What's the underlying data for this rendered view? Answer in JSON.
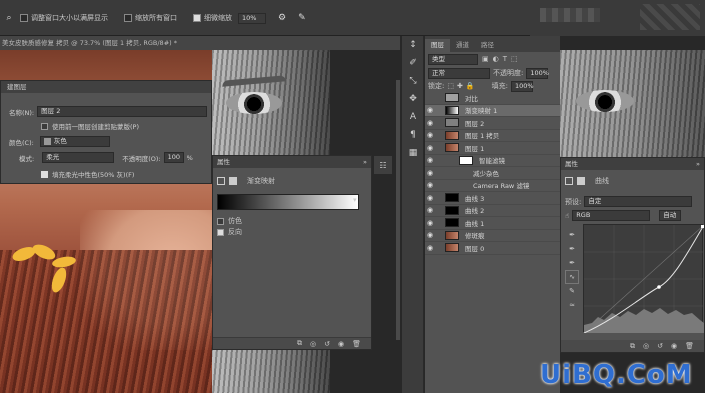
{
  "options_bar": {
    "resize_windows": "调整窗口大小以满屏显示",
    "zoom_all": "缩放所有窗口",
    "scrubby_zoom": "细微缩放",
    "zoom_value": "10%"
  },
  "document_tab": {
    "title": "美女皮肤质感修复 拷贝 @ 73.7% (图层 1 拷贝, RGB/8#) *"
  },
  "new_layer_dialog": {
    "title": "建图层",
    "name_label": "名称(N):",
    "name_value": "图层 2",
    "use_prev_label": "使用前一图层创建剪贴蒙版(P)",
    "color_label": "颜色(C):",
    "color_value": "灰色",
    "mode_label": "模式:",
    "mode_value": "柔光",
    "opacity_label": "不透明度(O):",
    "opacity_value": "100",
    "opacity_unit": "%",
    "fill_label": "填充柔光中性色(50% 灰)(F)"
  },
  "properties_gradient": {
    "title": "属性",
    "panel_name": "渐变映射",
    "dither_label": "仿色",
    "reverse_label": "反向"
  },
  "layers_panel": {
    "tabs": [
      "图层",
      "通道",
      "路径"
    ],
    "filter_kind": "类型",
    "blend_mode": "正常",
    "opacity_label": "不透明度:",
    "opacity_value": "100%",
    "lock_label": "锁定:",
    "fill_label": "填充:",
    "fill_value": "100%",
    "layers": [
      {
        "name": "对比",
        "visible": false,
        "kind": "group"
      },
      {
        "name": "渐变映射 1",
        "visible": true,
        "kind": "adjust"
      },
      {
        "name": "图层 2",
        "visible": true,
        "kind": "gray"
      },
      {
        "name": "图层 1 拷贝",
        "visible": true,
        "kind": "photo"
      },
      {
        "name": "图层 1",
        "visible": true,
        "kind": "photo"
      },
      {
        "name": "智能滤镜",
        "visible": true,
        "kind": "smart"
      },
      {
        "name": "减少杂色",
        "visible": true,
        "kind": "filter"
      },
      {
        "name": "Camera Raw 滤镜",
        "visible": true,
        "kind": "filter"
      },
      {
        "name": "曲线 3",
        "visible": true,
        "kind": "curve"
      },
      {
        "name": "曲线 2",
        "visible": true,
        "kind": "curve"
      },
      {
        "name": "曲线 1",
        "visible": true,
        "kind": "curve"
      },
      {
        "name": "修斑痕",
        "visible": true,
        "kind": "photo"
      },
      {
        "name": "图层 0",
        "visible": true,
        "kind": "photo"
      }
    ]
  },
  "properties_curves": {
    "title": "属性",
    "panel_name": "曲线",
    "preset_label": "预设:",
    "preset_value": "自定",
    "channel_value": "RGB",
    "auto_label": "自动"
  },
  "watermark": "UiBQ.CoM"
}
